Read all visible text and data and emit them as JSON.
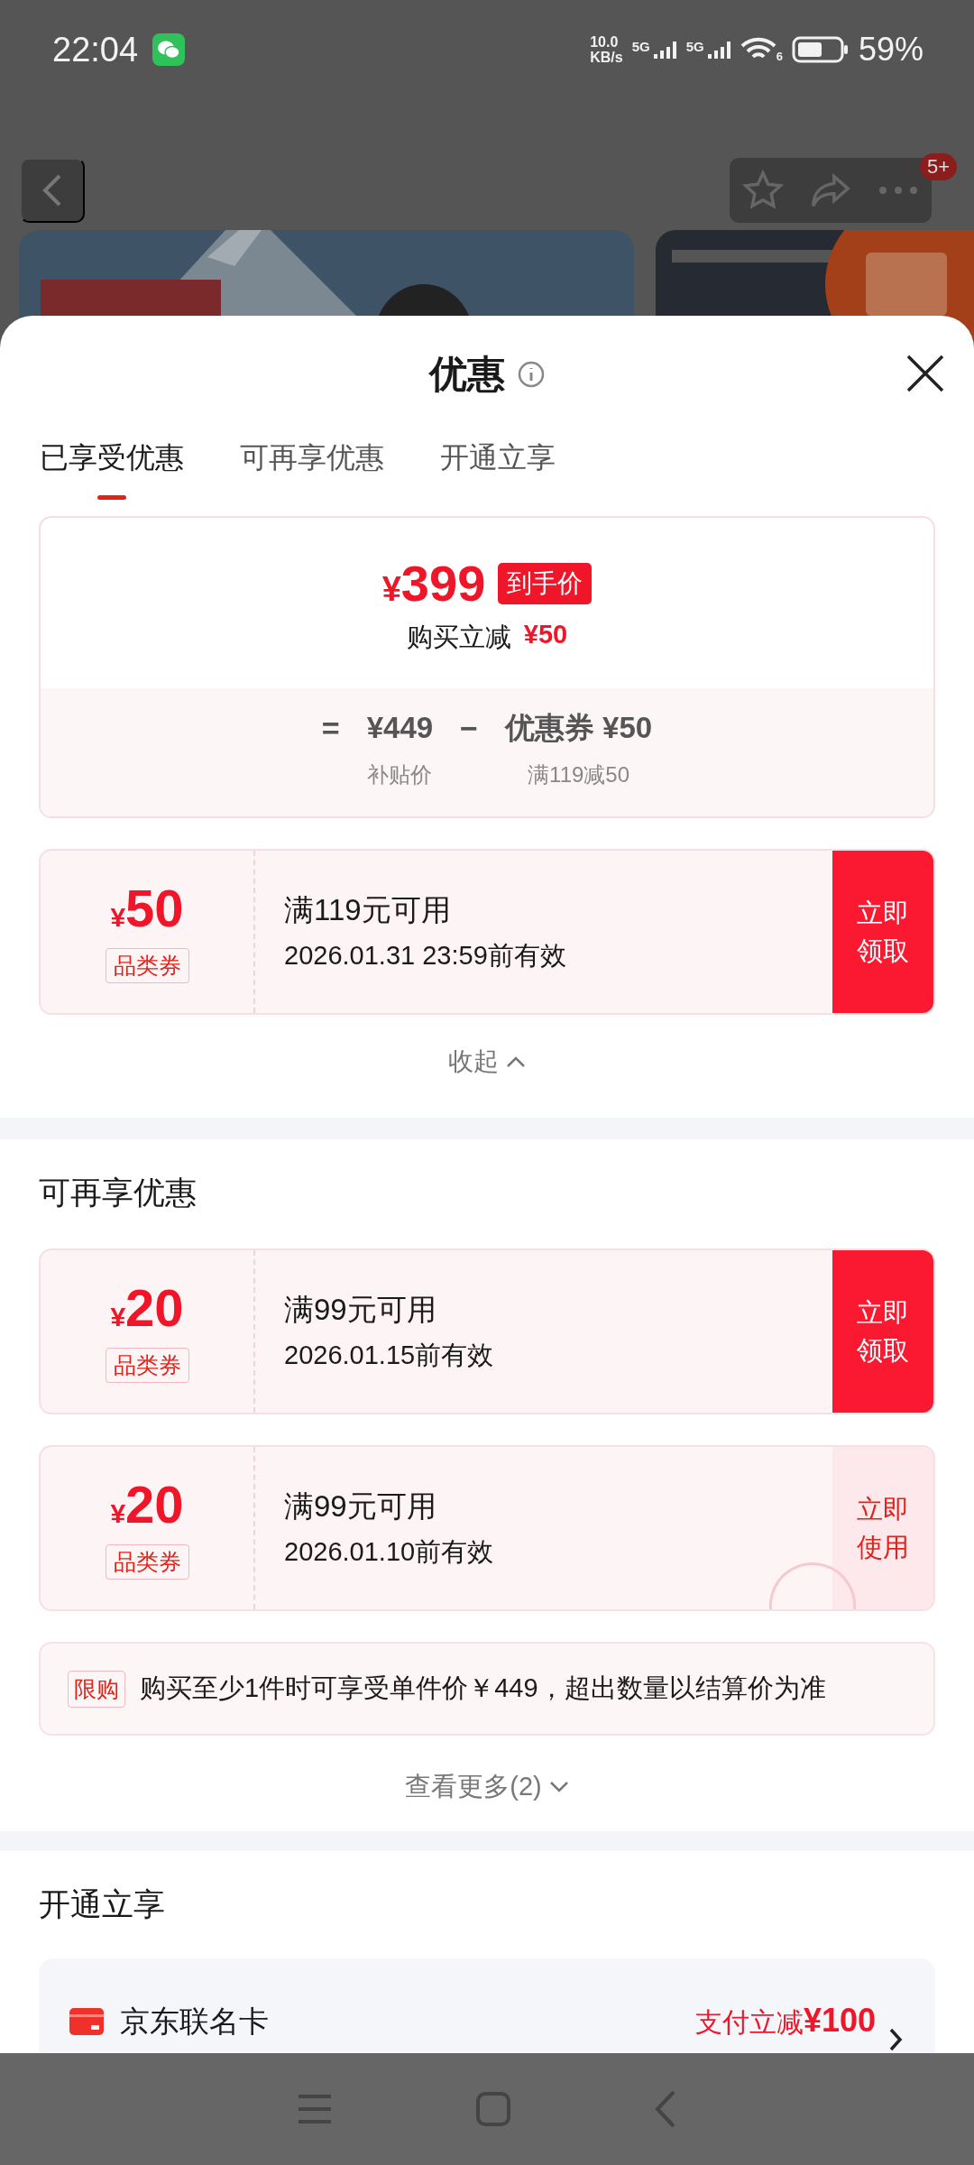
{
  "status_bar": {
    "time": "22:04",
    "speed": "10.0",
    "speed_unit": "KB/s",
    "networks": [
      "5G",
      "5G"
    ],
    "wifi_label": "6",
    "battery": "59%"
  },
  "header": {
    "badge": "5+"
  },
  "sheet": {
    "title": "优惠",
    "tabs": [
      {
        "label": "已享受优惠",
        "selected": true
      },
      {
        "label": "可再享优惠",
        "selected": false
      },
      {
        "label": "开通立享",
        "selected": false
      }
    ],
    "summary": {
      "currency": "¥",
      "price": "399",
      "price_tag": "到手价",
      "reduction_label": "购买立减",
      "reduction": "¥50",
      "formula": [
        {
          "kind": "op",
          "text": "="
        },
        {
          "kind": "term",
          "value": "¥449",
          "caption": "补贴价"
        },
        {
          "kind": "op",
          "text": "−"
        },
        {
          "kind": "term",
          "value": "优惠券 ¥50",
          "caption": "满119减50"
        }
      ]
    },
    "applied_coupons": [
      {
        "currency": "¥",
        "amount": "50",
        "type": "品类券",
        "condition": "满119元可用",
        "validity": "2026.01.31 23:59前有效",
        "action": "立即领取",
        "claimed": false
      }
    ],
    "collapse": "收起",
    "more_section": {
      "title": "可再享优惠",
      "coupons": [
        {
          "currency": "¥",
          "amount": "20",
          "type": "品类券",
          "condition": "满99元可用",
          "validity": "2026.01.15前有效",
          "action": "立即领取",
          "claimed": false
        },
        {
          "currency": "¥",
          "amount": "20",
          "type": "品类券",
          "condition": "满99元可用",
          "validity": "2026.01.10前有效",
          "action": "立即使用",
          "claimed": true
        }
      ],
      "limit": {
        "tag": "限购",
        "text": "购买至少1件时可享受单件价￥449，超出数量以结算价为准"
      },
      "view_more": "查看更多(2)"
    },
    "open_section": {
      "title": "开通立享",
      "card": {
        "name": "京东联名卡",
        "offer": "支付立减**¥100**"
      }
    }
  }
}
